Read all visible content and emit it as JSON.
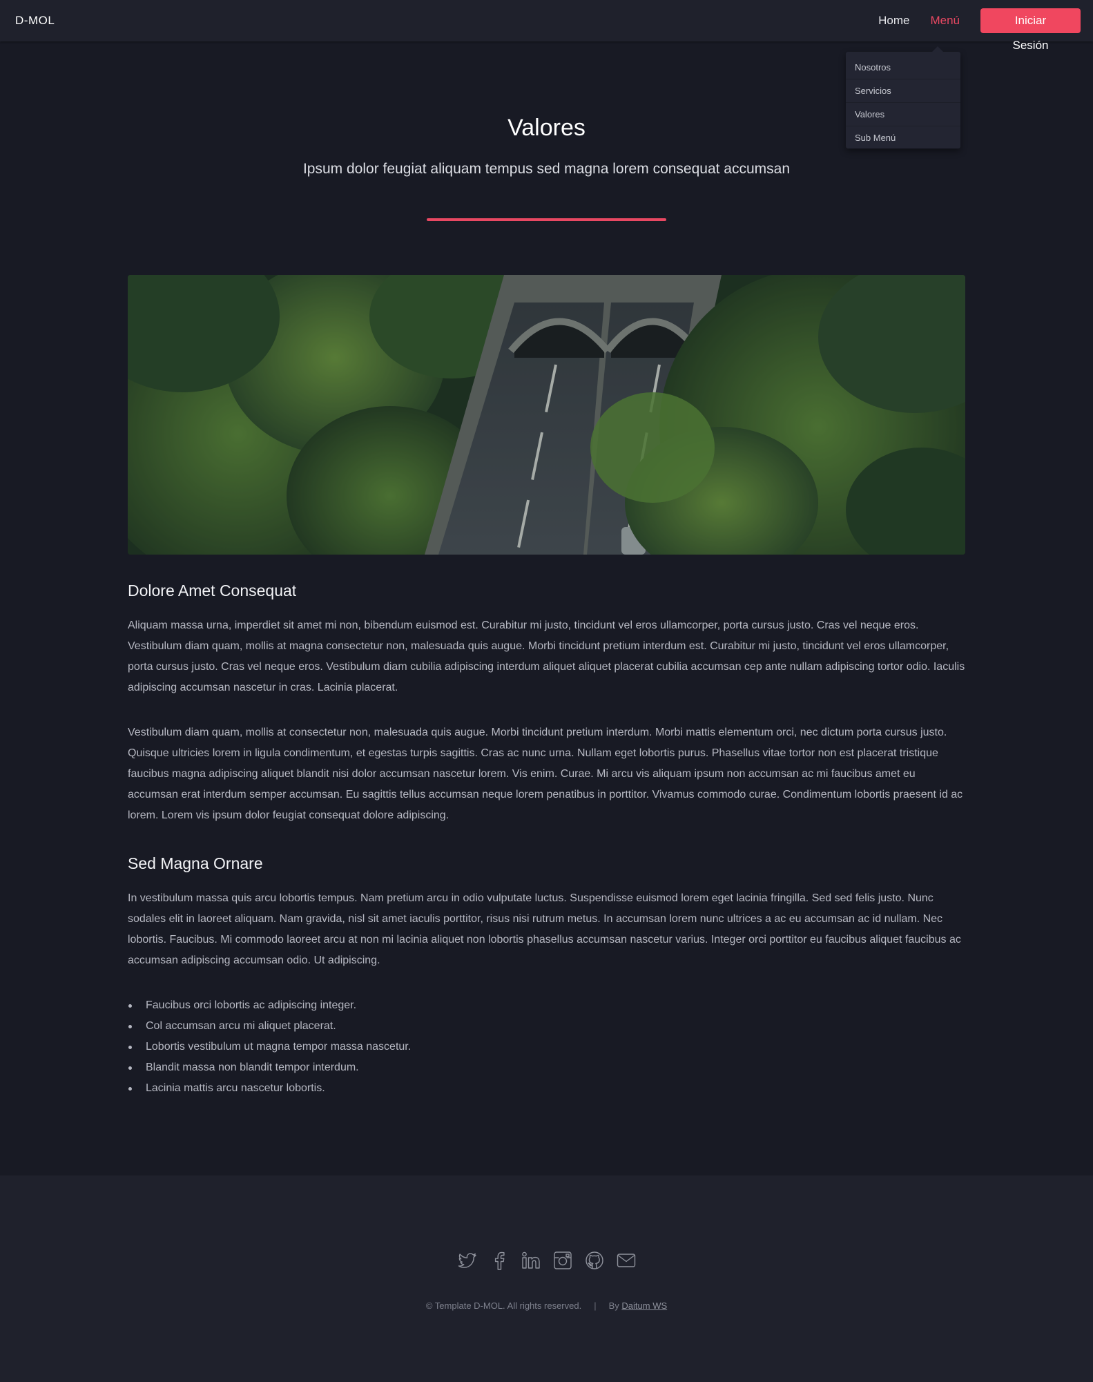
{
  "header": {
    "logo": "D-MOL",
    "nav": {
      "home": "Home",
      "menu": "Menú",
      "login": "Iniciar Sesión"
    },
    "dropdown": [
      "Nosotros",
      "Servicios",
      "Valores",
      "Sub Menú"
    ]
  },
  "hero": {
    "title": "Valores",
    "subtitle": "Ipsum dolor feugiat aliquam tempus sed magna lorem consequat accumsan"
  },
  "sections": {
    "s1_title": "Dolore Amet Consequat",
    "s1_p1": "Aliquam massa urna, imperdiet sit amet mi non, bibendum euismod est. Curabitur mi justo, tincidunt vel eros ullamcorper, porta cursus justo. Cras vel neque eros. Vestibulum diam quam, mollis at magna consectetur non, malesuada quis augue. Morbi tincidunt pretium interdum est. Curabitur mi justo, tincidunt vel eros ullamcorper, porta cursus justo. Cras vel neque eros. Vestibulum diam cubilia adipiscing interdum aliquet aliquet placerat cubilia accumsan cep ante nullam adipiscing tortor odio. Iaculis adipiscing accumsan nascetur in cras. Lacinia placerat.",
    "s1_p2": "Vestibulum diam quam, mollis at consectetur non, malesuada quis augue. Morbi tincidunt pretium interdum. Morbi mattis elementum orci, nec dictum porta cursus justo. Quisque ultricies lorem in ligula condimentum, et egestas turpis sagittis. Cras ac nunc urna. Nullam eget lobortis purus. Phasellus vitae tortor non est placerat tristique faucibus magna adipiscing aliquet blandit nisi dolor accumsan nascetur lorem. Vis enim. Curae. Mi arcu vis aliquam ipsum non accumsan ac mi faucibus amet eu accumsan erat interdum semper accumsan. Eu sagittis tellus accumsan neque lorem penatibus in porttitor. Vivamus commodo curae. Condimentum lobortis praesent id ac lorem. Lorem vis ipsum dolor feugiat consequat dolore adipiscing.",
    "s2_title": "Sed Magna Ornare",
    "s2_p1": "In vestibulum massa quis arcu lobortis tempus. Nam pretium arcu in odio vulputate luctus. Suspendisse euismod lorem eget lacinia fringilla. Sed sed felis justo. Nunc sodales elit in laoreet aliquam. Nam gravida, nisl sit amet iaculis porttitor, risus nisi rutrum metus. In accumsan lorem nunc ultrices a ac eu accumsan ac id nullam. Nec lobortis. Faucibus. Mi commodo laoreet arcu at non mi lacinia aliquet non lobortis phasellus accumsan nascetur varius. Integer orci porttitor eu faucibus aliquet faucibus ac accumsan adipiscing accumsan odio. Ut adipiscing.",
    "bullets": [
      "Faucibus orci lobortis ac adipiscing integer.",
      "Col accumsan arcu mi aliquet placerat.",
      "Lobortis vestibulum ut magna tempor massa nascetur.",
      "Blandit massa non blandit tempor interdum.",
      "Lacinia mattis arcu nascetur lobortis."
    ]
  },
  "footer": {
    "socials": [
      "twitter-icon",
      "facebook-icon",
      "linkedin-icon",
      "instagram-icon",
      "github-icon",
      "email-icon"
    ],
    "copyright": "© Template D-MOL. All rights reserved.",
    "separator": "|",
    "by_prefix": "By",
    "author": "Daitum WS"
  },
  "colors": {
    "accent": "#e84862",
    "background": "#181a24",
    "header_bg": "#1f212c"
  }
}
